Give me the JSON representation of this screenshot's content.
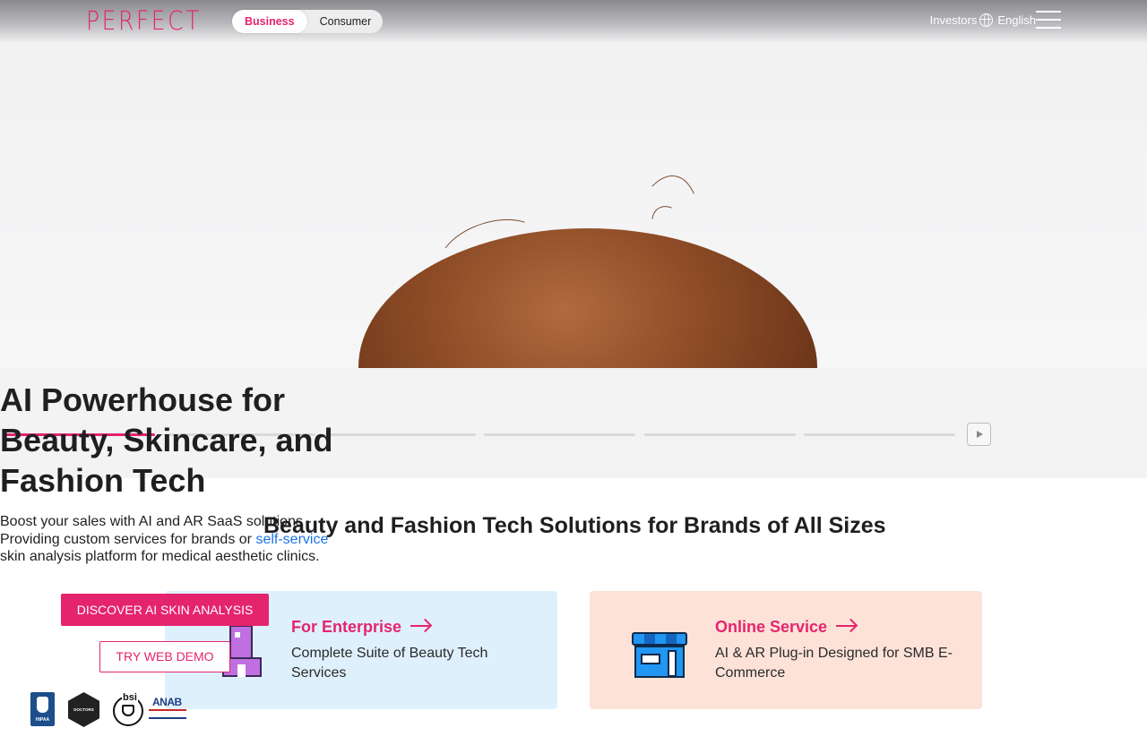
{
  "header": {
    "logo": "PERFECT",
    "segments": [
      {
        "label": "Business",
        "active": true
      },
      {
        "label": "Consumer",
        "active": false
      }
    ],
    "investors": "Investors",
    "language": "English"
  },
  "hero": {
    "title": "AI Powerhouse for Beauty, Skincare, and Fashion Tech",
    "description_before_link": "Boost your sales with AI and AR SaaS solutions - Providing custom services for brands or ",
    "description_link": "self-service",
    "description_after_link": " skin analysis platform for medical aesthetic clinics.",
    "primary_button": "DISCOVER AI SKIN ANALYSIS",
    "secondary_button": "TRY WEB DEMO",
    "carousel": {
      "slides": 6,
      "active_index": 0
    }
  },
  "section": {
    "title": "Beauty and Fashion Tech Solutions for Brands of All Sizes",
    "cards": [
      {
        "title": "For Enterprise",
        "description": "Complete Suite of Beauty Tech Services",
        "icon": "building-icon"
      },
      {
        "title": "Online Service",
        "description": "AI & AR Plug-in Designed for SMB E-Commerce",
        "icon": "store-icon"
      }
    ]
  },
  "badges": {
    "hipaa": "HIPAA",
    "doctors": "DOCTORS",
    "bsi": "bsi",
    "anab": "ANAB"
  },
  "colors": {
    "brand": "#e5246e",
    "link": "#1a73e8",
    "enterprise_card": "#dff0fd",
    "online_card": "#fde2d8"
  }
}
